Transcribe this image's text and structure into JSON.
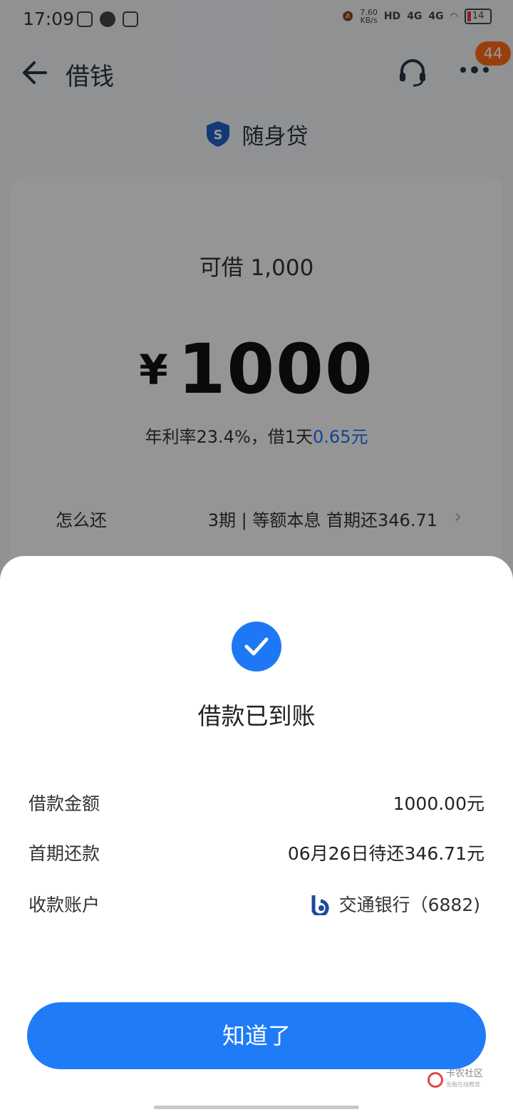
{
  "status_bar": {
    "time": "17:09",
    "net_speed": "7.60",
    "net_speed_unit": "KB/s",
    "hd": "HD",
    "network1": "4G",
    "network2": "4G",
    "battery": "14"
  },
  "navbar": {
    "title": "借钱",
    "badge_count": "44"
  },
  "product": {
    "name": "随身贷"
  },
  "loan_card": {
    "available": "可借 1,000",
    "currency": "¥",
    "amount": "1000",
    "rate_text": "年利率23.4%，借1天",
    "rate_highlight": "0.65元",
    "repay_label": "怎么还",
    "repay_detail": "3期 | 等额本息  首期还346.71",
    "accent_color": "#1e6ff5"
  },
  "success_sheet": {
    "title": "借款已到账",
    "rows": [
      {
        "label": "借款金额",
        "value": "1000.00元"
      },
      {
        "label": "首期还款",
        "value": "06月26日待还346.71元"
      },
      {
        "label": "收款账户",
        "value": "交通银行（6882)"
      }
    ],
    "button_label": "知道了",
    "button_color": "#1f7cf6"
  },
  "watermark": {
    "text": "卡农社区",
    "sub": "金融在线教育"
  }
}
